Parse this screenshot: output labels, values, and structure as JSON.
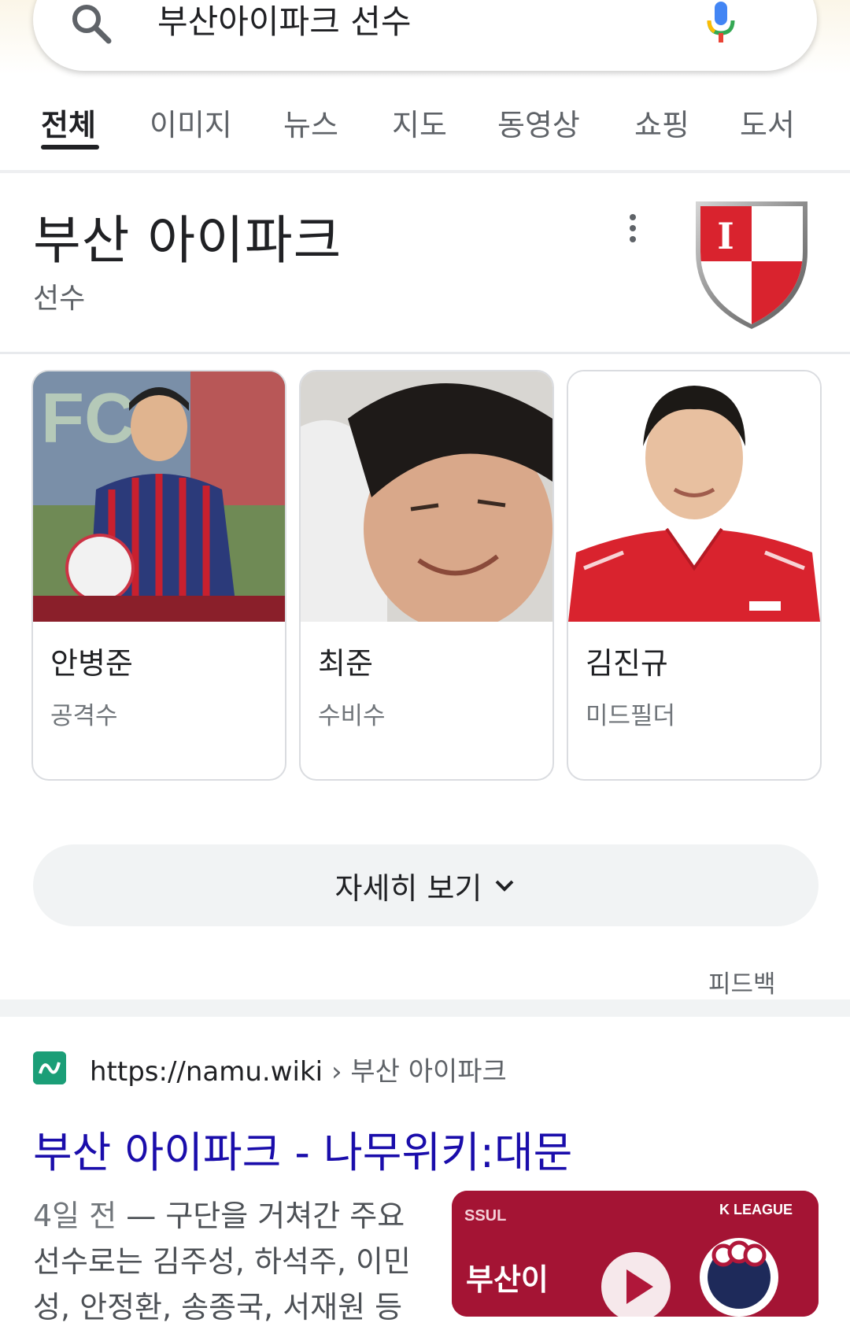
{
  "search": {
    "query": "부산아이파크 선수"
  },
  "tabs": [
    {
      "label": "전체",
      "active": true
    },
    {
      "label": "이미지"
    },
    {
      "label": "뉴스"
    },
    {
      "label": "지도"
    },
    {
      "label": "동영상"
    },
    {
      "label": "쇼핑"
    },
    {
      "label": "도서"
    }
  ],
  "knowledge_panel": {
    "title": "부산 아이파크",
    "subtitle": "선수",
    "crest_letter": "I",
    "players": [
      {
        "name": "안병준",
        "position": "공격수"
      },
      {
        "name": "최준",
        "position": "수비수"
      },
      {
        "name": "김진규",
        "position": "미드필더"
      }
    ],
    "more_label": "자세히 보기",
    "feedback": "피드백"
  },
  "result": {
    "url": "https://namu.wiki",
    "breadcrumb": "› 부산 아이파크",
    "title": "부산 아이파크 - 나무위키:대문",
    "snippet_date": "4일 전",
    "snippet_text": " — 구단을 거쳐간 주요 선수로는 김주성, 하석주, 이민성, 안정환, 송종국, 서재원 등",
    "thumb_badge": "K LEAGUE",
    "thumb_text": "부산이"
  },
  "colors": {
    "link": "#1a0dab",
    "active_tab": "#202124",
    "inactive_tab": "#5f6368",
    "crest_red": "#d9232e",
    "thumb_bg": "#b0173a"
  }
}
